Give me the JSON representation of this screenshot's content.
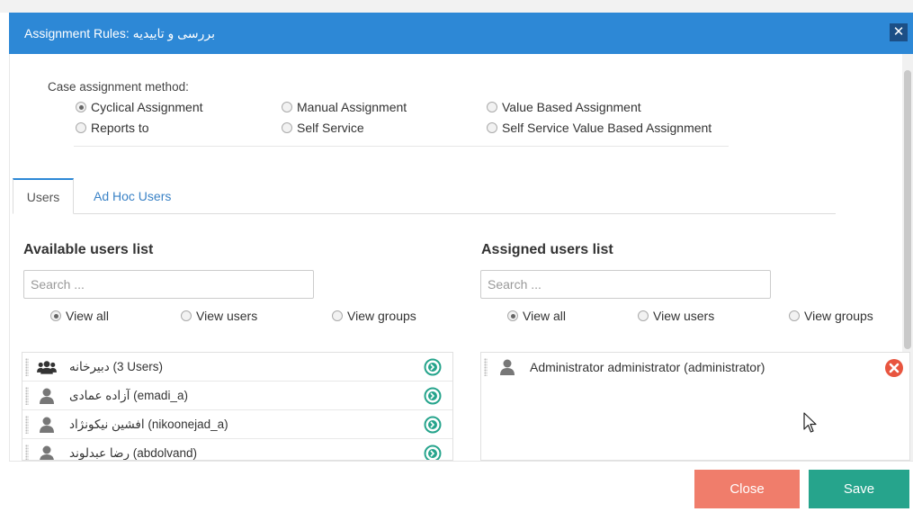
{
  "window": {
    "title": "Assignment Rules: بررسی و تاییدیه",
    "close_glyph": "✕"
  },
  "method": {
    "label": "Case assignment method:",
    "options": [
      {
        "label": "Cyclical Assignment",
        "selected": true
      },
      {
        "label": "Manual Assignment",
        "selected": false
      },
      {
        "label": "Value Based Assignment",
        "selected": false
      },
      {
        "label": "Reports to",
        "selected": false
      },
      {
        "label": "Self Service",
        "selected": false
      },
      {
        "label": "Self Service Value Based Assignment",
        "selected": false
      }
    ]
  },
  "tabs": {
    "users": "Users",
    "adhoc": "Ad Hoc Users",
    "active": "users"
  },
  "available": {
    "title": "Available users list",
    "search_placeholder": "Search ...",
    "filters": [
      "View all",
      "View users",
      "View groups"
    ],
    "selected_filter": "View all",
    "rows": [
      {
        "text": "دبیرخانه (3 Users)",
        "icon": "group-icon"
      },
      {
        "text": "آزاده عمادی (emadi_a)",
        "icon": "user-icon"
      },
      {
        "text": "افشین نیکونژاد (nikoonejad_a)",
        "icon": "user-icon"
      },
      {
        "text": "رضا عبدلوند (abdolvand)",
        "icon": "user-icon"
      }
    ]
  },
  "assigned": {
    "title": "Assigned users list",
    "search_placeholder": "Search ...",
    "filters": [
      "View all",
      "View users",
      "View groups"
    ],
    "selected_filter": "View all",
    "rows": [
      {
        "text": "Administrator administrator (administrator)",
        "icon": "user-icon"
      }
    ]
  },
  "footer": {
    "close_label": "Close",
    "save_label": "Save"
  },
  "colors": {
    "header": "#2d88d6",
    "close_button": "#f07d6b",
    "save_button": "#26a48c",
    "add_icon": "#26a48c",
    "remove_icon": "#e8553f"
  }
}
